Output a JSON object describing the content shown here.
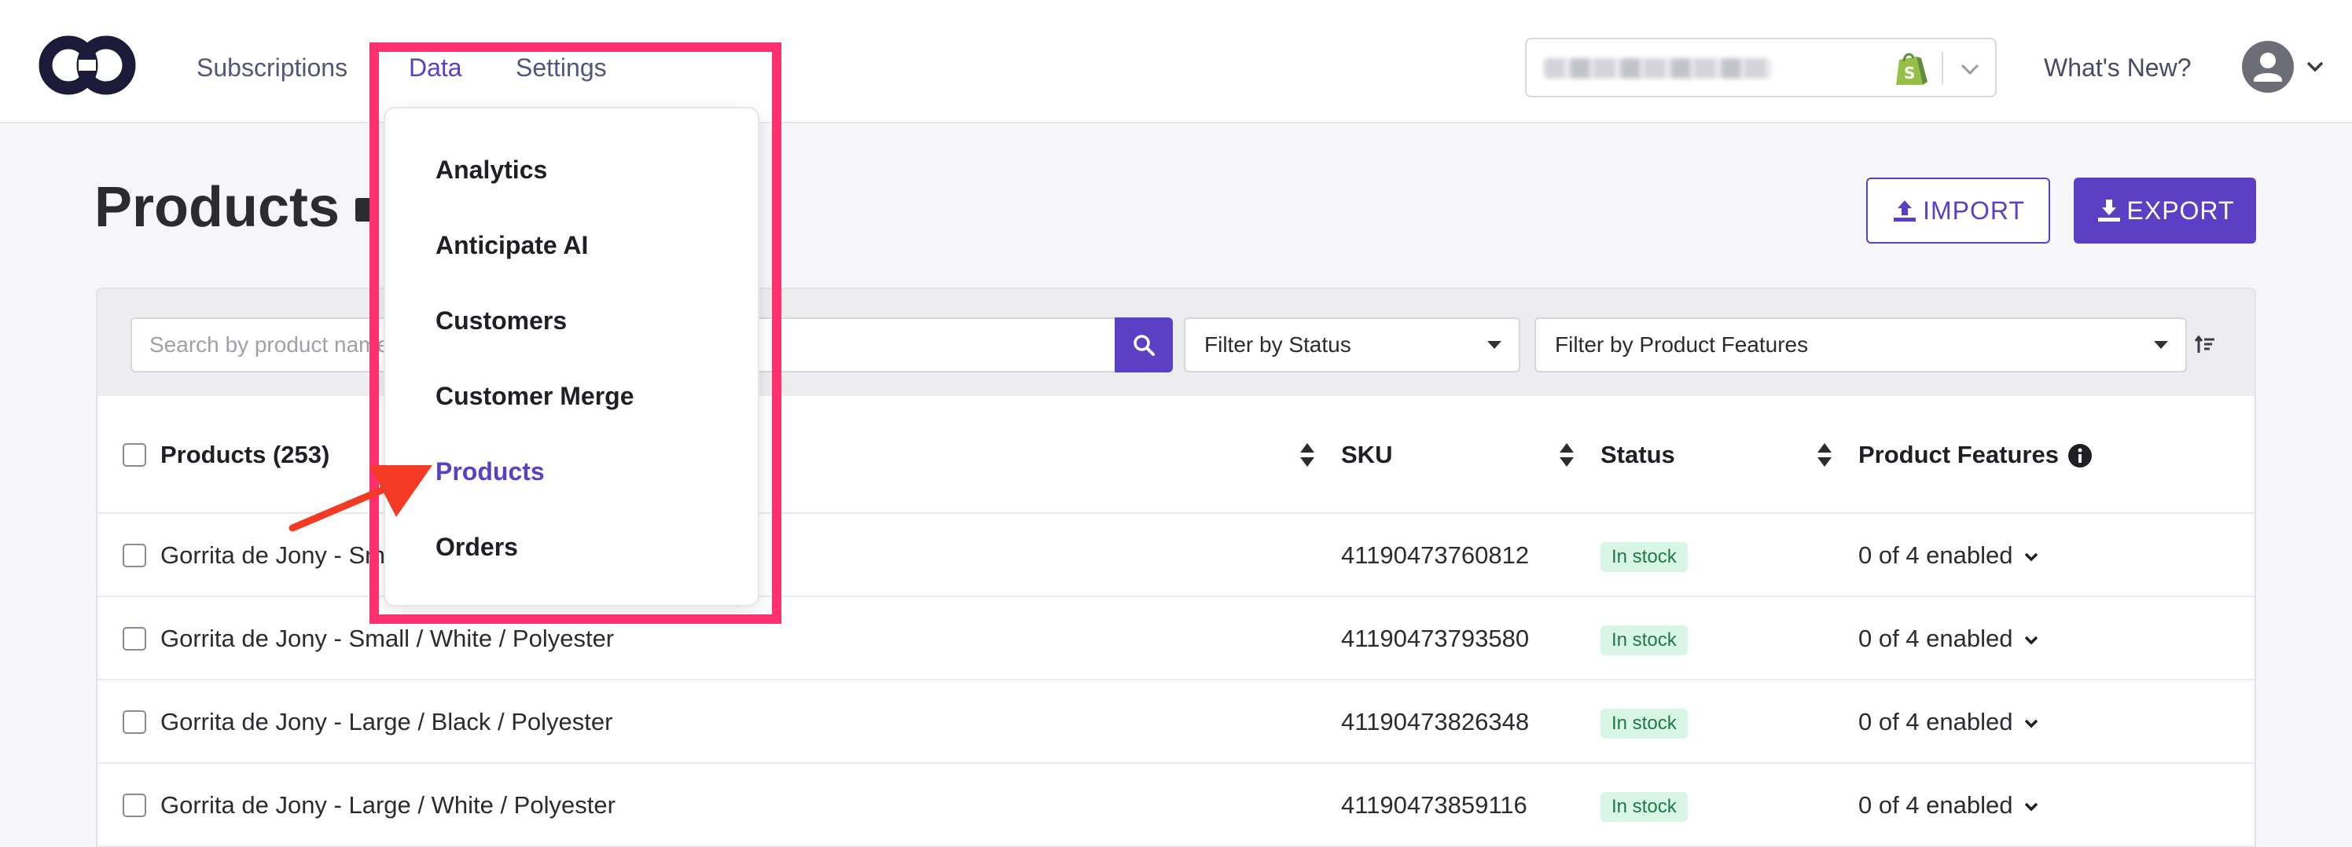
{
  "nav": {
    "subscriptions": "Subscriptions",
    "data": "Data",
    "settings": "Settings",
    "whats_new": "What's New?"
  },
  "dropdown": {
    "items": [
      "Analytics",
      "Anticipate AI",
      "Customers",
      "Customer Merge",
      "Products",
      "Orders"
    ],
    "active": "Products"
  },
  "page": {
    "title": "Products",
    "import_label": "IMPORT",
    "export_label": "EXPORT"
  },
  "filters": {
    "search_placeholder": "Search by product name",
    "status": "Filter by Status",
    "features": "Filter by Product Features"
  },
  "table": {
    "headers": {
      "product": "Products (253)",
      "sku": "SKU",
      "status": "Status",
      "features": "Product Features"
    },
    "rows": [
      {
        "name": "Gorrita de Jony - Small / Black / Polyester",
        "sku": "41190473760812",
        "status": "In stock",
        "features": "0 of 4 enabled"
      },
      {
        "name": "Gorrita de Jony - Small / White / Polyester",
        "sku": "41190473793580",
        "status": "In stock",
        "features": "0 of 4 enabled"
      },
      {
        "name": "Gorrita de Jony - Large / Black / Polyester",
        "sku": "41190473826348",
        "status": "In stock",
        "features": "0 of 4 enabled"
      },
      {
        "name": "Gorrita de Jony - Large / White / Polyester",
        "sku": "41190473859116",
        "status": "In stock",
        "features": "0 of 4 enabled"
      }
    ]
  },
  "colors": {
    "accent": "#5b3fc4",
    "highlight": "#ff2e6e",
    "arrow": "#f23a24",
    "badge_bg": "#d9f5e6",
    "badge_text": "#1d7a48"
  }
}
